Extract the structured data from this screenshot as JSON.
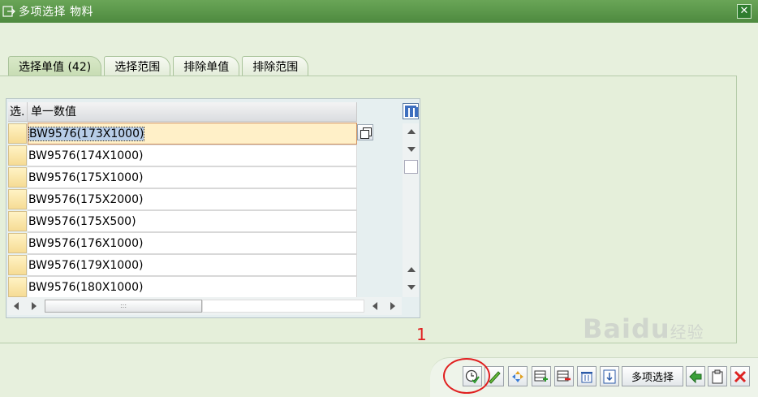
{
  "window": {
    "title": "多项选择 物料"
  },
  "tabs": [
    {
      "label": "选择单值 (42)",
      "active": true
    },
    {
      "label": "选择范围",
      "active": false
    },
    {
      "label": "排除单值",
      "active": false
    },
    {
      "label": "排除范围",
      "active": false
    }
  ],
  "table": {
    "col_select": "选.",
    "col_value": "单一数值",
    "rows": [
      "BW9576(173X1000)",
      "BW9576(174X1000)",
      "BW9576(175X1000)",
      "BW9576(175X2000)",
      "BW9576(175X500)",
      "BW9576(176X1000)",
      "BW9576(179X1000)",
      "BW9576(180X1000)"
    ]
  },
  "annotation": {
    "mark": "1",
    "color": "#e02020"
  },
  "toolbar": {
    "buttons": [
      {
        "name": "execute-button",
        "icon": "clock-check-icon"
      },
      {
        "name": "check-button",
        "icon": "pencil-check-icon"
      },
      {
        "name": "options-button",
        "icon": "diamond-arrows-icon"
      },
      {
        "name": "insert-row-button",
        "icon": "insert-row-icon"
      },
      {
        "name": "delete-row-button",
        "icon": "delete-row-icon"
      },
      {
        "name": "delete-all-button",
        "icon": "trash-icon"
      },
      {
        "name": "import-button",
        "icon": "text-import-icon"
      }
    ],
    "multi_select_label": "多项选择",
    "buttons_after": [
      {
        "name": "paste-button",
        "icon": "green-arrow-icon"
      },
      {
        "name": "clipboard-button",
        "icon": "clipboard-icon"
      },
      {
        "name": "cancel-button",
        "icon": "red-x-icon"
      }
    ]
  },
  "watermark": {
    "brand": "Bai",
    "mid": "du",
    "cn": "经验"
  },
  "colors": {
    "titlebar": "#4e8a3f",
    "background": "#e7f0dd",
    "annotation": "#e02020"
  }
}
